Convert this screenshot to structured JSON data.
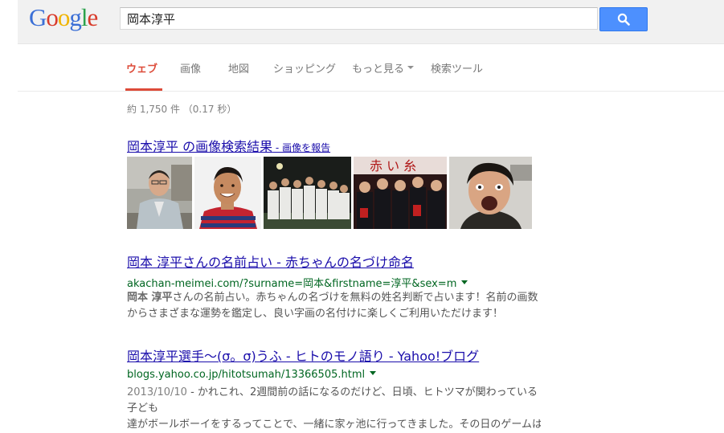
{
  "logo": {
    "letters": [
      "G",
      "o",
      "o",
      "g",
      "l",
      "e"
    ],
    "colors": [
      "#3b6fd6",
      "#d93b2b",
      "#f0b400",
      "#3b6fd6",
      "#2ca24c",
      "#d93b2b"
    ]
  },
  "search": {
    "value": "岡本淳平"
  },
  "tabs": [
    {
      "label": "ウェブ"
    },
    {
      "label": "画像"
    },
    {
      "label": "地図"
    },
    {
      "label": "ショッピング"
    },
    {
      "label": "もっと見る"
    },
    {
      "label": "検索ツール"
    }
  ],
  "stats": "約 1,750 件 （0.17 秒）",
  "image_result": {
    "title_bold": "岡本淳平",
    "title_rest": " の画像検索結果",
    "report": " - 画像を報告"
  },
  "results": [
    {
      "title_bold": "岡本 淳平",
      "title_rest": "さんの名前占い - 赤ちゃんの名づけ命名",
      "url": "akachan-meimei.com/?surname=岡本&firstname=淳平&sex=m",
      "snippet_bold": "岡本 淳平",
      "snippet_l1": "さんの名前占い。赤ちゃんの名づけを無料の姓名判断で占います！名前の画数",
      "snippet_l2": "からさまざまな運勢を鑑定し、良い字画の名付けに楽しくご利用いただけます！"
    },
    {
      "title_bold": "岡本淳平",
      "title_rest": "選手〜(σ。σ)うふ - ヒトのモノ語り - Yahoo!ブログ",
      "url": "blogs.yahoo.co.jp/hitotsumah/13366505.html",
      "date": "2013/10/10",
      "snippet_l1": " - かれこれ、2週間前の話になるのだけど、日頃、ヒトツマが関わっている子ども",
      "snippet_l2": "達がボールボーイをするってことで、一緒に家ヶ池に行ってきました。その日のゲームはトッ"
    }
  ]
}
